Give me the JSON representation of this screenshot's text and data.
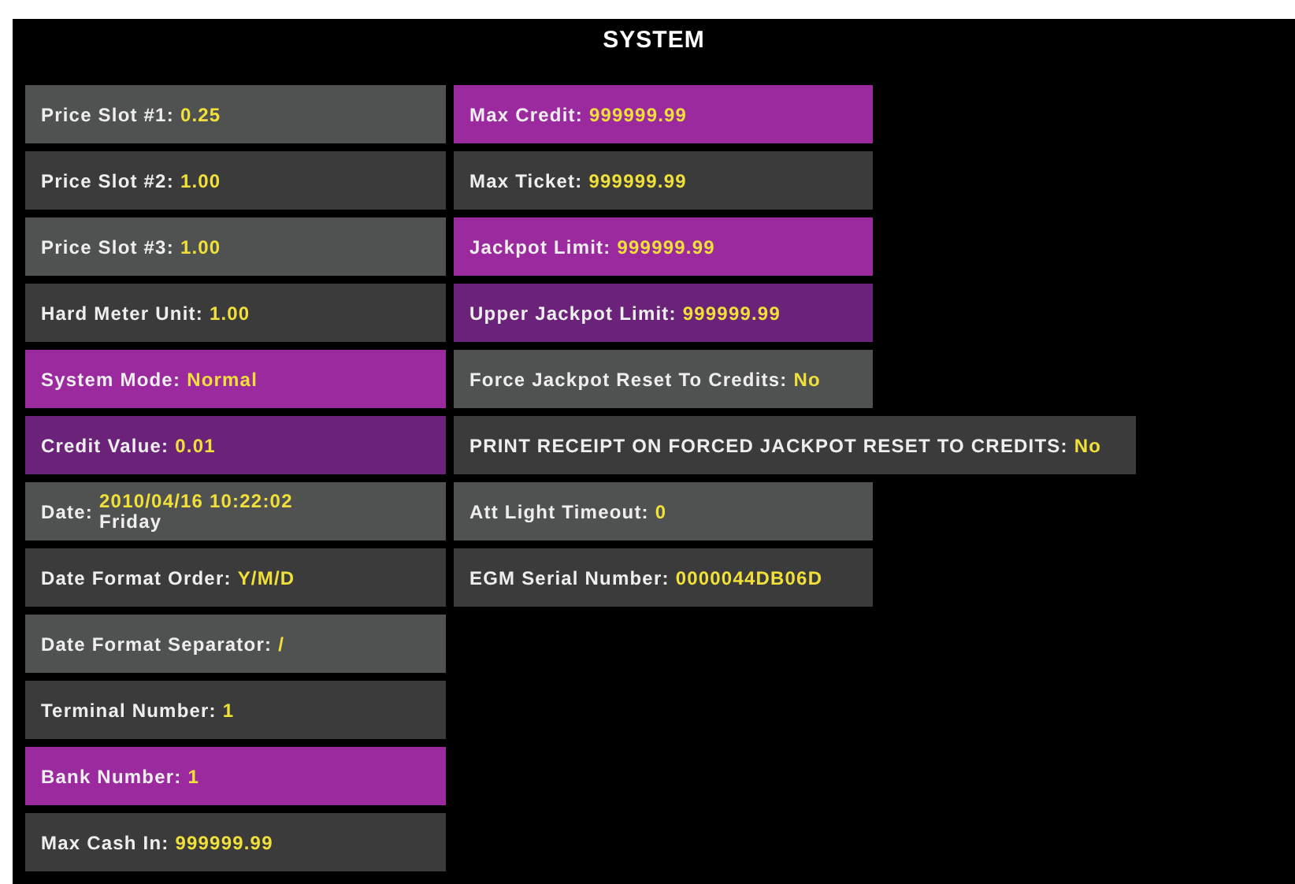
{
  "title": "SYSTEM",
  "columns": [
    {
      "items": [
        {
          "label": "Price Slot #1:",
          "value": "0.25",
          "color": "#4f5250"
        },
        {
          "label": "Price Slot #2:",
          "value": "1.00",
          "color": "#3b3b3b"
        },
        {
          "label": "Price Slot #3:",
          "value": "1.00",
          "color": "#4f5250"
        },
        {
          "label": "Hard Meter Unit:",
          "value": "1.00",
          "color": "#3b3b3b"
        },
        {
          "label": "System Mode:",
          "value": "Normal",
          "color": "#9a2a9e"
        },
        {
          "label": "Credit Value:",
          "value": "0.01",
          "color": "#6a2378"
        },
        {
          "label": "Date:",
          "value": "2010/04/16 10:22:02",
          "sub_value": "Friday",
          "color": "#4f5250"
        },
        {
          "label": "Date Format Order:",
          "value": "Y/M/D",
          "color": "#3b3b3b"
        },
        {
          "label": "Date Format Separator:",
          "value": "/",
          "color": "#4f5250"
        },
        {
          "label": "Terminal Number:",
          "value": "1",
          "color": "#3b3b3b"
        },
        {
          "label": "Bank Number:",
          "value": "1",
          "color": "#9a2a9e"
        },
        {
          "label": "Max Cash In:",
          "value": "999999.99",
          "color": "#3b3b3b"
        }
      ]
    },
    {
      "items": [
        {
          "label": "Max Credit:",
          "value": "999999.99",
          "color": "#9a2a9e"
        },
        {
          "label": "Max Ticket:",
          "value": "999999.99",
          "color": "#3b3b3b"
        },
        {
          "label": "Jackpot Limit:",
          "value": "999999.99",
          "color": "#9a2a9e"
        },
        {
          "label": "Upper Jackpot Limit:",
          "value": "999999.99",
          "color": "#6a2378"
        },
        {
          "label": "Force Jackpot Reset To Credits:",
          "value": "No",
          "color": "#4f5250"
        },
        {
          "label": "PRINT RECEIPT ON FORCED JACKPOT RESET TO CREDITS:",
          "value": "No",
          "color": "#3b3b3b"
        },
        {
          "label": "Att Light Timeout:",
          "value": "0",
          "color": "#4f5250"
        },
        {
          "label": "EGM Serial Number:",
          "value": "0000044DB06D",
          "color": "#3b3b3b"
        }
      ]
    }
  ]
}
